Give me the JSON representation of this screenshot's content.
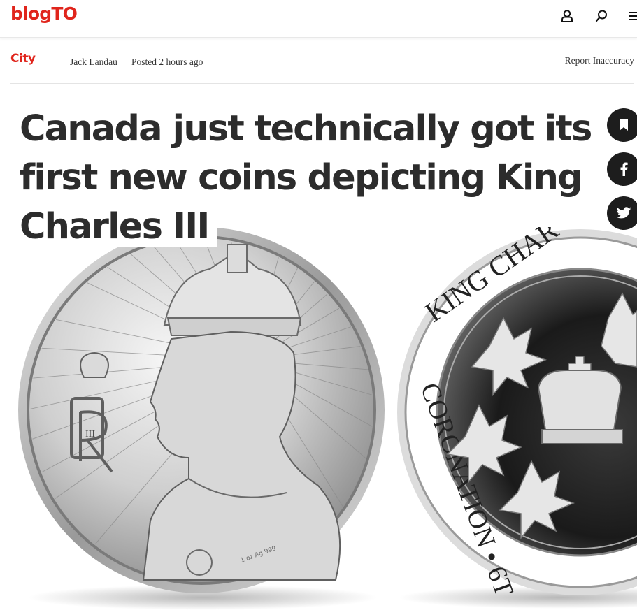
{
  "header": {
    "logo": "blogTO",
    "icons": [
      "user-icon",
      "search-icon",
      "menu-icon"
    ]
  },
  "meta": {
    "category": "City",
    "author": "Jack Landau",
    "posted": "Posted 2 hours ago",
    "report": "Report Inaccuracy"
  },
  "article": {
    "headline": "Canada just technically got its first new coins depicting King Charles III"
  },
  "hero": {
    "coin_left_text": "1 oz Ag 999",
    "coin_right_text_top": "KING CHAR",
    "coin_right_text_bottom": "CORONATION • 6T"
  },
  "share": {
    "icons": [
      "bookmark-icon",
      "facebook-icon",
      "twitter-icon"
    ]
  },
  "colors": {
    "brand": "#e0251c",
    "text": "#2c2c2c",
    "share_bg": "#1d1d1d"
  }
}
